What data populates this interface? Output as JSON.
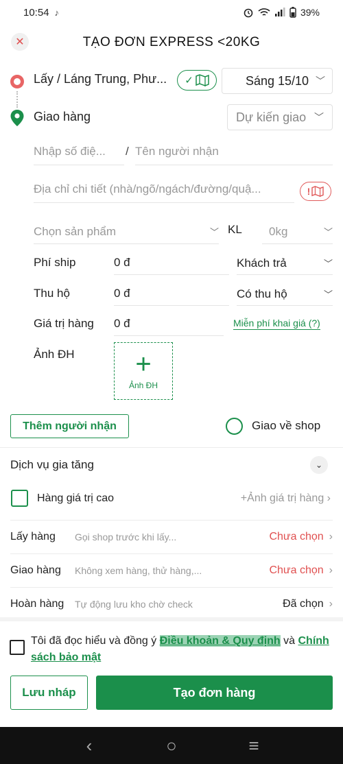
{
  "status": {
    "time": "10:54",
    "battery": "39%"
  },
  "header": {
    "title": "TẠO ĐƠN EXPRESS <20KG",
    "close_icon": "close-icon"
  },
  "pickup": {
    "label": "Lấy / Láng Trung, Phư...",
    "date": "Sáng 15/10"
  },
  "delivery": {
    "label": "Giao hàng",
    "date_placeholder": "Dự kiến giao"
  },
  "recipient": {
    "phone_placeholder": "Nhập số điệ...",
    "separator": "/",
    "name_placeholder": "Tên người nhận",
    "address_placeholder": "Địa chỉ chi tiết (nhà/ngõ/ngách/đường/quậ..."
  },
  "product": {
    "placeholder": "Chọn sản phẩm",
    "weight_label": "KL",
    "weight_value": "0kg"
  },
  "fees": {
    "ship_label": "Phí ship",
    "ship_value": "0 đ",
    "ship_payer": "Khách trả",
    "cod_label": "Thu hộ",
    "cod_value": "0 đ",
    "cod_option": "Có thu hộ",
    "goods_value_label": "Giá trị hàng",
    "goods_value": "0 đ",
    "free_declare_link": "Miễn phí khai giá (?)"
  },
  "photo": {
    "label": "Ảnh ĐH",
    "button_caption": "Ảnh ĐH"
  },
  "actions": {
    "add_recipient": "Thêm người nhận",
    "return_to_shop": "Giao về shop"
  },
  "services": {
    "title": "Dịch vụ gia tăng",
    "high_value_label": "Hàng giá trị cao",
    "high_value_action": "+Ảnh giá trị hàng",
    "rows": [
      {
        "name": "Lấy hàng",
        "desc": "Gọi shop trước khi lấy...",
        "value": "Chưa chọn"
      },
      {
        "name": "Giao hàng",
        "desc": "Không xem hàng, thử hàng,...",
        "value": "Chưa chọn"
      },
      {
        "name": "Hoàn hàng",
        "desc": "Tự động lưu kho chờ check",
        "value": "Đã chọn"
      }
    ]
  },
  "terms": {
    "prefix": "Tôi đã đọc hiểu và đồng ý ",
    "terms_link": "Điều khoản & Quy định",
    "middle": " và ",
    "privacy_link": "Chính sách bảo mật"
  },
  "buttons": {
    "save_draft": "Lưu nháp",
    "create_order": "Tạo đơn hàng"
  },
  "colors": {
    "brand_green": "#1b8f4b",
    "alert_red": "#e05050"
  }
}
